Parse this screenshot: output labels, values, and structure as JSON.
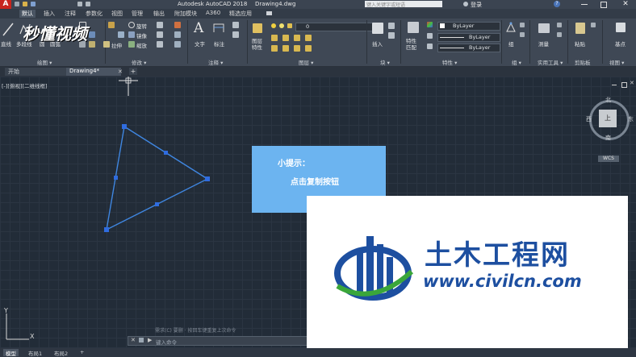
{
  "titlebar": {
    "app_title": "Autodesk AutoCAD 2018",
    "doc_title": "Drawing4.dwg",
    "search_placeholder": "键入关键字或短语",
    "login": "登录"
  },
  "ribbon_tabs": [
    "默认",
    "插入",
    "注释",
    "参数化",
    "视图",
    "管理",
    "输出",
    "附加模块",
    "A360",
    "精选应用"
  ],
  "ribbon": {
    "line": "直线",
    "polyline": "多段线",
    "circle": "圆",
    "arc": "圆弧",
    "move": "移动",
    "rotate": "旋转",
    "copy": "复制",
    "mirror": "镜像",
    "stretch": "拉伸",
    "scale": "缩放",
    "text": "文字",
    "dimension": "标注",
    "layer_props": "图层特性",
    "layer_value": "0",
    "insert": "插入",
    "match_props": "特性匹配",
    "bylayer_color": "ByLayer",
    "bylayer_linetype": "ByLayer",
    "bylayer_lineweight": "ByLayer",
    "group": "组",
    "measure": "测量",
    "paste": "粘贴",
    "base": "基点",
    "panels": [
      "绘图 ▾",
      "修改 ▾",
      "注释 ▾",
      "图层 ▾",
      "块 ▾",
      "特性 ▾",
      "组 ▾",
      "实用工具 ▾",
      "剪贴板",
      "视图 ▾"
    ]
  },
  "filetabs": [
    "开始",
    "Drawing4*"
  ],
  "viewport": {
    "view_label": "[-][俯视][二维线框]",
    "viewcube": {
      "north": "北",
      "south": "南",
      "east": "东",
      "west": "西",
      "top": "上",
      "wcs": "WCS"
    },
    "axis_x": "X",
    "axis_y": "Y"
  },
  "tooltip": {
    "title": "小提示：",
    "body": "点击复制按钮"
  },
  "watermark_top": "秒懂视频",
  "watermark_logo": {
    "name": "土木工程网",
    "url": "www.civilcn.com"
  },
  "command": {
    "history": "需求(C) 要删 · 按回车键重复上次命令",
    "placeholder": "键入命令"
  },
  "layout_tabs": [
    "模型",
    "布局1",
    "布局2",
    "+"
  ],
  "colors": {
    "triangle": "#3f86e0",
    "grip": "#2f6ce0",
    "tooltip_bg": "#6cb4f0",
    "logo_blue": "#1d4fa0",
    "logo_green": "#3aa63a"
  }
}
